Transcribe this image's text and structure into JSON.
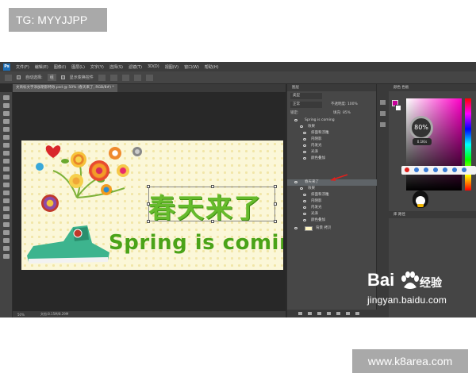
{
  "watermarks": {
    "top": "TG: MYYJJPP",
    "bottom": "www.k8area.com"
  },
  "menubar": {
    "logo": "Ps",
    "items": [
      "文件(F)",
      "编辑(E)",
      "图像(I)",
      "图层(L)",
      "文字(Y)",
      "选择(S)",
      "滤镜(T)",
      "3D(D)",
      "视图(V)",
      "窗口(W)",
      "帮助(H)"
    ]
  },
  "options_bar": {
    "auto_select": "自动选择:",
    "select_value": "组",
    "show_transform": "显示变换控件"
  },
  "document_tab": "文商标文字添加阴影特效.psd @ 50% (春天来了, RGB/8#) *",
  "status_bar": {
    "zoom": "50%",
    "doc_info": "文档:8.15M/8.29M"
  },
  "canvas": {
    "title_cn": "春天来了",
    "title_en": "Spring is coming"
  },
  "layers_panel": {
    "title": "图层",
    "kind": "类型",
    "blend": "正常",
    "opacity": "不透明度: 100%",
    "lock": "锁定:",
    "fill": "填充: 85%",
    "layers": [
      {
        "label": "Spring is coming",
        "kind": "text",
        "selected": false
      },
      {
        "label": "效果",
        "kind": "effect",
        "selected": false
      },
      {
        "label": "斜面和浮雕",
        "kind": "effect",
        "selected": false
      },
      {
        "label": "内阴影",
        "kind": "effect",
        "selected": false
      },
      {
        "label": "内发光",
        "kind": "effect",
        "selected": false
      },
      {
        "label": "光泽",
        "kind": "effect",
        "selected": false
      },
      {
        "label": "颜色叠加",
        "kind": "effect",
        "selected": false
      },
      {
        "label": "春天来了",
        "kind": "text",
        "selected": true
      },
      {
        "label": "效果",
        "kind": "effect",
        "selected": false
      },
      {
        "label": "斜面和浮雕",
        "kind": "effect",
        "selected": false
      },
      {
        "label": "内阴影",
        "kind": "effect",
        "selected": false
      },
      {
        "label": "内发光",
        "kind": "effect",
        "selected": false
      },
      {
        "label": "光泽",
        "kind": "effect",
        "selected": false
      },
      {
        "label": "颜色叠加",
        "kind": "effect",
        "selected": false
      },
      {
        "label": "背景 拷贝",
        "kind": "image",
        "selected": false
      }
    ]
  },
  "color_panel": {
    "tabs": "颜色  色板",
    "foreground_color": "#c8009a",
    "background_color": "#ffffff",
    "gauge_value": "80%",
    "gauge_sub": "0.1K/s",
    "secondary_tabs": "库  路径"
  },
  "baidu_watermark": {
    "brand": "Bai",
    "brand_cn": "经验",
    "url": "jingyan.baidu.com"
  }
}
